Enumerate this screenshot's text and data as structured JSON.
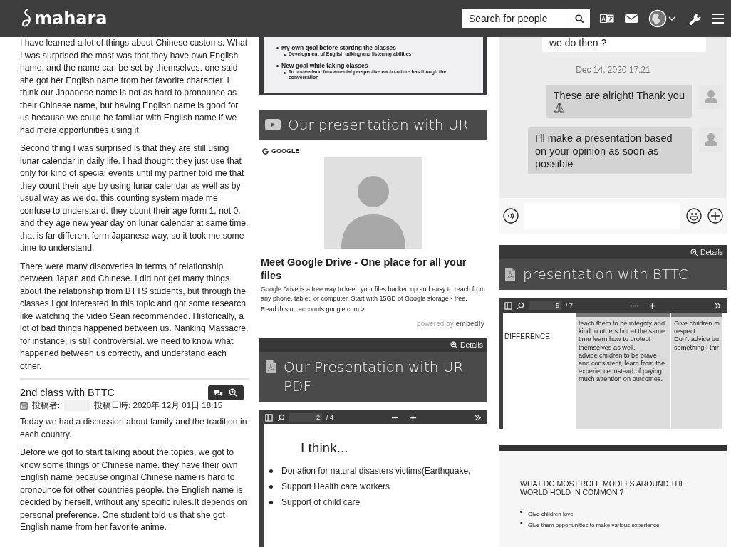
{
  "header": {
    "logo": "mahara",
    "search": {
      "placeholder": "Search for people"
    }
  },
  "left": {
    "paragraphs": [
      "I have learned a lot of things about Chinese customs. What I was surprised the most was that they have own English name, and the name can be set by themselves. one said she got her English name from her favorite character. I think our Japanese name is not as hard to pronounce as their Chinese name, but having English name is good for us because we could be familiar with English name if we had more opportunities using it.",
      "Second thing I was surprised is that they are still using lunar calendar in daily life. I had thought they just use that only for kind of special events until my partner told me that they count their age by using lunar calendar as well as by usual way as we do. this counting system made me confuse to understand. they count their age form 1, not 0. and they age new year day on lunar calendar at same time. that is far different form Japanese way, so it took me some time to understand.",
      "There were many discoveries in terms of relationship between Japan and Chinese. I did not get many things about the relationship from BTTS students, but through the classes I got interested in this topic and  got some research like watching the video Sean recommended. Historically, a lot of bad things happened between us. Nanking Massacre, for instance, is still controversial. we need to know what happened between us correctly, and understand each other."
    ],
    "post": {
      "title": "2nd class with BTTC",
      "author_label": "投稿者:",
      "date": "投稿日時: 2020年 12月 01日 18:15",
      "paragraphs": [
        "Today we had a discussion about family and the tradition in each country.",
        "Before we got to start talking about the topics, we got to know some things of Chinese name. they have their own English name because original Chinese name is hard to pronounce for other countries people. the English name is decided by herself, without any specific rules.It depends on personal preference. One student told us that she got English name from her favorite anime."
      ]
    }
  },
  "middle": {
    "slide": {
      "bullets": [
        {
          "text": "My own goal before starting the classes",
          "children": [
            {
              "text": "Development of English talking and listening abilities"
            }
          ]
        },
        {
          "text": "New goal while taking classes",
          "children": [
            {
              "text": "To understand fundamental perspective each culture has though the conversation"
            }
          ]
        }
      ]
    },
    "video_block": {
      "title": "Our presentation with UR",
      "source": "GOOGLE",
      "link_title": "Meet Google Drive - One place for all your files",
      "description": "Google Drive is a free way to keep your files backed up and easy to reach from any phone, tablet, or computer. Start with 15GB of Google storage - free.",
      "read_link": "Read this on accounts.google.com >",
      "powered_by": "powered by",
      "brand": "embedly"
    },
    "pdf_block": {
      "details": "Details",
      "title": "Our Presentation with UR PDF",
      "viewer": {
        "page": "2",
        "total": "/ 4",
        "heading": "I think...",
        "bullets": [
          "Donation for natural disasters victims(Earthquake,",
          "Support Health care workers",
          "Support of child care"
        ]
      }
    }
  },
  "right": {
    "chat": {
      "messages": [
        {
          "kind": "incoming",
          "text": "we do then ?"
        },
        {
          "kind": "timestamp",
          "text": "Dec 14, 2020 17:21"
        },
        {
          "kind": "outgoing",
          "text": "These are alright! Thank you",
          "emoji": true
        },
        {
          "kind": "outgoing",
          "text": "I’ll make a presentation based on your opinion as soon as possible",
          "emoji": false
        }
      ]
    },
    "pdf_block": {
      "details": "Details",
      "title": "presentation with BTTC",
      "viewer": {
        "page": "5",
        "total": "/ 7",
        "label": "DIFFERENCE",
        "cells": [
          "teach them to be integrity and kind to others but at the same time learn how to protect themselves as well,\nadvice children to be brave and consistent, learn from the experience instead of paying much attention on outcomes.",
          "Give children m\nrespect\nDon't advice bu\nsomething I thir"
        ]
      }
    },
    "slide": {
      "heading": "WHAT DO MOST ROLE MODELS AROUND THE WORLD HOLD IN COMMON ?",
      "bullets": [
        "Give children love",
        "Give them opportunities to make various experience"
      ]
    }
  }
}
